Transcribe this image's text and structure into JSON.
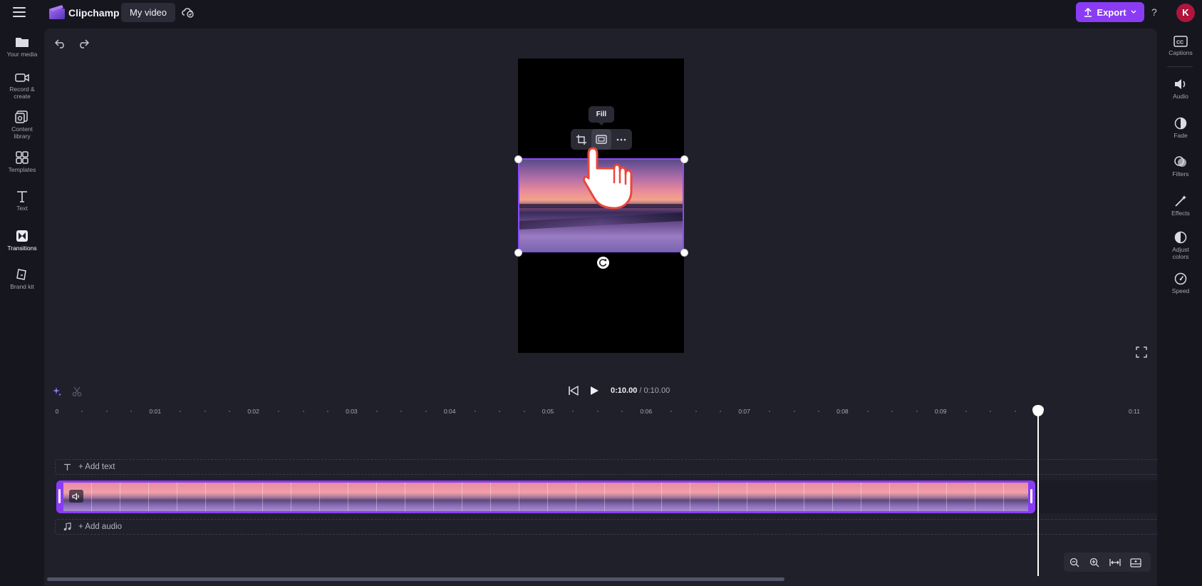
{
  "app": {
    "name": "Clipchamp",
    "project_title": "My video"
  },
  "header": {
    "export_label": "Export",
    "help_label": "?",
    "avatar_initial": "K"
  },
  "left_nav": [
    {
      "label": "Your media",
      "icon": "folder-icon"
    },
    {
      "label": "Record & create",
      "icon": "camera-icon"
    },
    {
      "label": "Content library",
      "icon": "content-library-icon"
    },
    {
      "label": "Templates",
      "icon": "templates-icon"
    },
    {
      "label": "Text",
      "icon": "text-icon"
    },
    {
      "label": "Transitions",
      "icon": "transitions-icon",
      "active": true
    },
    {
      "label": "Brand kit",
      "icon": "brand-kit-icon"
    }
  ],
  "right_nav": [
    {
      "label": "Captions",
      "icon": "captions-icon"
    },
    {
      "label": "Audio",
      "icon": "speaker-icon"
    },
    {
      "label": "Fade",
      "icon": "fade-icon"
    },
    {
      "label": "Filters",
      "icon": "filters-icon"
    },
    {
      "label": "Effects",
      "icon": "magic-wand-icon"
    },
    {
      "label": "Adjust colors",
      "icon": "adjust-colors-icon"
    },
    {
      "label": "Speed",
      "icon": "speedometer-icon"
    }
  ],
  "preview": {
    "tooltip": "Fill",
    "toolbar": [
      "crop-icon",
      "fill-icon",
      "more-icon"
    ]
  },
  "playback": {
    "current_time": "0:10.00",
    "separator": " / ",
    "total_time": "0:10.00"
  },
  "ruler": [
    "0",
    "0:01",
    "0:02",
    "0:03",
    "0:04",
    "0:05",
    "0:06",
    "0:07",
    "0:08",
    "0:09",
    "0:11"
  ],
  "tracks": {
    "add_text": "+ Add text",
    "add_audio": "+ Add audio"
  },
  "colors": {
    "accent": "#8a3cf5",
    "background": "#16161f",
    "panel": "#20202b",
    "avatar": "#b0153d"
  }
}
